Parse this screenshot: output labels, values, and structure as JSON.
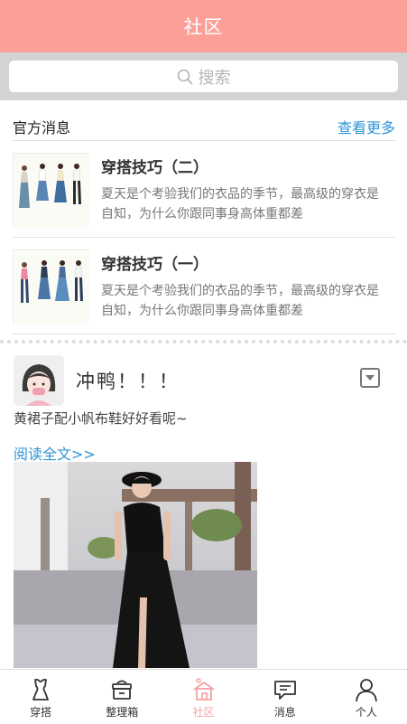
{
  "header": {
    "title": "社区"
  },
  "search": {
    "placeholder": "搜索"
  },
  "official": {
    "title": "官方消息",
    "more_label": "查看更多",
    "items": [
      {
        "title": "穿搭技巧（二）",
        "desc": "夏天是个考验我们的衣品的季节，最高级的穿衣是自知，为什么你跟同事身高体重都差"
      },
      {
        "title": "穿搭技巧（一）",
        "desc": "夏天是个考验我们的衣品的季节，最高级的穿衣是自知，为什么你跟同事身高体重都差"
      }
    ]
  },
  "post": {
    "username": "冲鸭！！！",
    "text": "黄裙子配小帆布鞋好好看呢~",
    "read_more": "阅读全文>>"
  },
  "tabbar": {
    "active": "社区",
    "items": [
      {
        "label": "穿搭",
        "icon": "outfit-icon"
      },
      {
        "label": "整理箱",
        "icon": "wardrobe-box-icon"
      },
      {
        "label": "社区",
        "icon": "community-house-icon"
      },
      {
        "label": "消息",
        "icon": "message-icon"
      },
      {
        "label": "个人",
        "icon": "person-icon"
      }
    ]
  },
  "colors": {
    "header": "#fb9f98",
    "link": "#2f94d6",
    "tab_active": "#f6a0a3"
  }
}
